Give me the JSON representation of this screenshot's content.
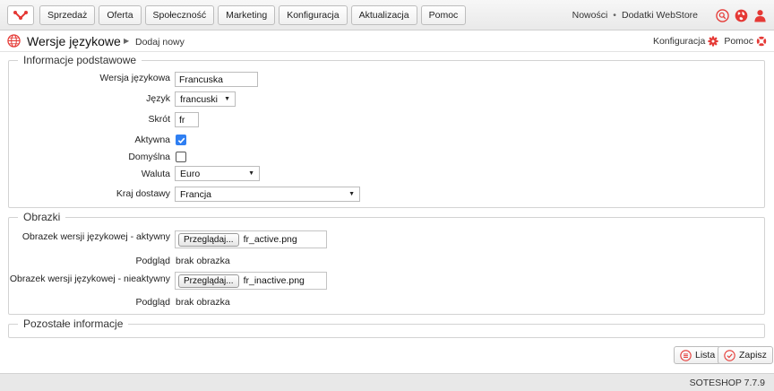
{
  "topbar": {
    "nav": [
      "Sprzedaż",
      "Oferta",
      "Społeczność",
      "Marketing",
      "Konfiguracja",
      "Aktualizacja",
      "Pomoc"
    ],
    "news_link": "Nowości",
    "separator": "•",
    "addons_link": "Dodatki WebStore",
    "icons": [
      "search-icon",
      "globe-icon",
      "user-icon"
    ]
  },
  "header": {
    "title": "Wersje językowe",
    "breadcrumb_sep": "▶",
    "breadcrumb": "Dodaj nowy",
    "config_link": "Konfiguracja",
    "help_link": "Pomoc"
  },
  "basic": {
    "legend": "Informacje podstawowe",
    "version_label": "Wersja językowa",
    "version_value": "Francuska",
    "language_label": "Język",
    "language_value": "francuski",
    "short_label": "Skrót",
    "short_value": "fr",
    "active_label": "Aktywna",
    "active_checked": true,
    "default_label": "Domyślna",
    "default_checked": false,
    "currency_label": "Waluta",
    "currency_value": "Euro",
    "country_label": "Kraj dostawy",
    "country_value": "Francja"
  },
  "images": {
    "legend": "Obrazki",
    "active_label": "Obrazek wersji językowej - aktywny",
    "browse_label": "Przeglądaj...",
    "active_file": "fr_active.png",
    "preview_label": "Podgląd",
    "preview_value": "brak obrazka",
    "inactive_label": "Obrazek wersji językowej - nieaktywny",
    "inactive_file": "fr_inactive.png"
  },
  "other": {
    "legend": "Pozostałe informacje"
  },
  "actions": {
    "list_label": "Lista",
    "save_label": "Zapisz"
  },
  "footer": {
    "version": "SOTESHOP 7.7.9"
  },
  "colors": {
    "accent_red": "#e53935",
    "checkbox_blue": "#2f7ff2"
  }
}
